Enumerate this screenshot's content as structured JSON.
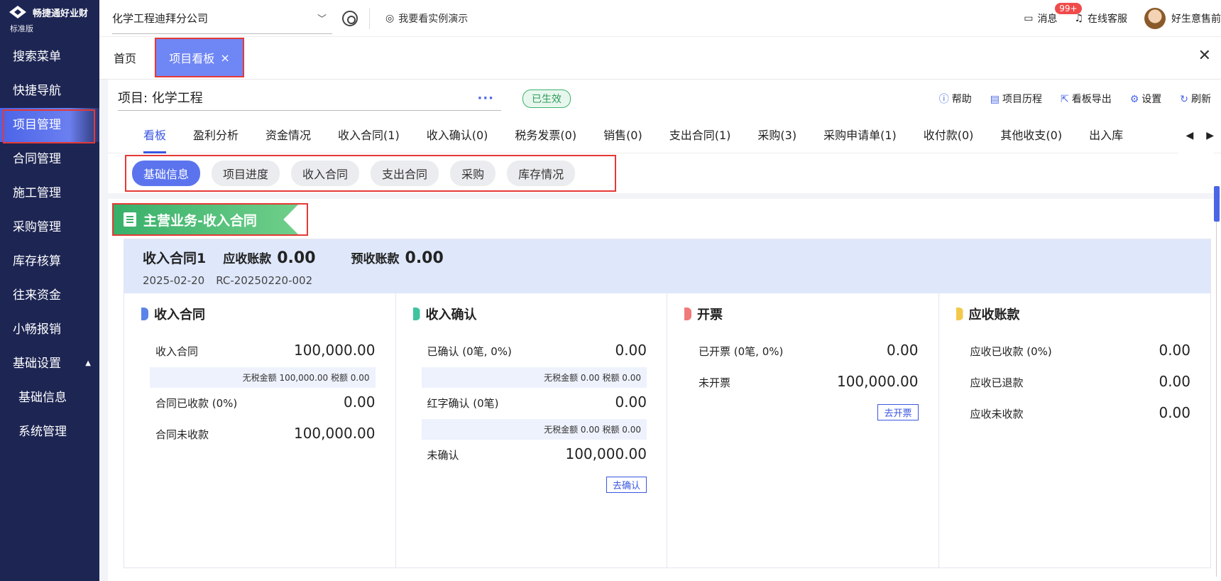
{
  "sidebar": {
    "brand": "畅捷通好业财",
    "edition": "标准版",
    "items": [
      {
        "label": "搜索菜单"
      },
      {
        "label": "快捷导航"
      },
      {
        "label": "项目管理"
      },
      {
        "label": "合同管理"
      },
      {
        "label": "施工管理"
      },
      {
        "label": "采购管理"
      },
      {
        "label": "库存核算"
      },
      {
        "label": "往来资金"
      },
      {
        "label": "小畅报销"
      },
      {
        "label": "基础设置"
      },
      {
        "label": "基础信息"
      },
      {
        "label": "系统管理"
      }
    ],
    "active_index": 2
  },
  "topbar": {
    "company": "化学工程迪拜分公司",
    "demo": "我要看实例演示",
    "messages": "消息",
    "badge": "99+",
    "service": "在线客服",
    "user": "好生意售前"
  },
  "tabs": {
    "home": "首页",
    "active": "项目看板"
  },
  "project": {
    "title": "项目: 化学工程",
    "more": "···",
    "status": "已生效",
    "actions": [
      "帮助",
      "项目历程",
      "看板导出",
      "设置",
      "刷新"
    ]
  },
  "subtabs": [
    "看板",
    "盈利分析",
    "资金情况",
    "收入合同(1)",
    "收入确认(0)",
    "税务发票(0)",
    "销售(0)",
    "支出合同(1)",
    "采购(3)",
    "采购申请单(1)",
    "收付款(0)",
    "其他收支(0)",
    "出入库"
  ],
  "chips": [
    "基础信息",
    "项目进度",
    "收入合同",
    "支出合同",
    "采购",
    "库存情况"
  ],
  "section": {
    "title": "主营业务-收入合同"
  },
  "contract": {
    "name": "收入合同1",
    "receivable_label": "应收账款",
    "receivable": "0.00",
    "prepaid_label": "预收账款",
    "prepaid": "0.00",
    "date": "2025-02-20",
    "code": "RC-20250220-002"
  },
  "columns": {
    "c1": {
      "title": "收入合同",
      "r1_label": "收入合同",
      "r1_value": "100,000.00",
      "note": "无税金额 100,000.00 税额 0.00",
      "r2_label": "合同已收款 (0%)",
      "r2_value": "0.00",
      "r3_label": "合同未收款",
      "r3_value": "100,000.00"
    },
    "c2": {
      "title": "收入确认",
      "r1_label": "已确认 (0笔, 0%)",
      "r1_value": "0.00",
      "note1": "无税金额 0.00 税额 0.00",
      "r2_label": "红字确认 (0笔)",
      "r2_value": "0.00",
      "note2": "无税金额 0.00 税额 0.00",
      "r3_label": "未确认",
      "r3_value": "100,000.00",
      "button": "去确认"
    },
    "c3": {
      "title": "开票",
      "r1_label": "已开票 (0笔, 0%)",
      "r1_value": "0.00",
      "r2_label": "未开票",
      "r2_value": "100,000.00",
      "button": "去开票"
    },
    "c4": {
      "title": "应收账款",
      "r1_label": "应收已收款 (0%)",
      "r1_value": "0.00",
      "r2_label": "应收已退款",
      "r2_value": "0.00",
      "r3_label": "应收未收款",
      "r3_value": "0.00"
    }
  },
  "colors": {
    "sidebar": "#1d2553",
    "accent": "#4a66e6",
    "status_green": "#3bb36b",
    "highlight": "#e53935"
  }
}
